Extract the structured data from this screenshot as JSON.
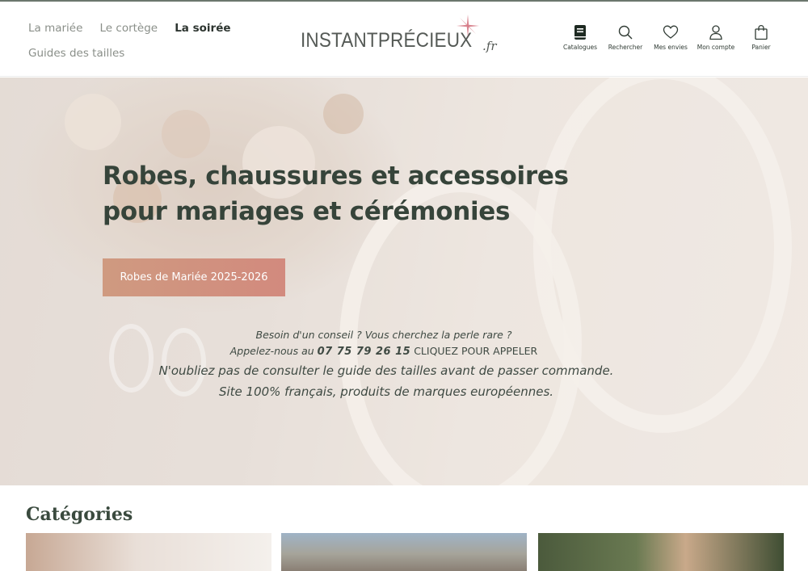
{
  "header": {
    "nav": [
      {
        "label": "La mariée",
        "active": false
      },
      {
        "label": "Le cortège",
        "active": false
      },
      {
        "label": "La soirée",
        "active": true
      },
      {
        "label": "Guides des tailles",
        "active": false
      }
    ],
    "logo": {
      "main": "INSTANTPRÉCIEUX",
      "suffix": ".fr"
    },
    "icons": [
      {
        "name": "catalog-icon",
        "label": "Catalogues"
      },
      {
        "name": "search-icon",
        "label": "Rechercher"
      },
      {
        "name": "heart-icon",
        "label": "Mes envies"
      },
      {
        "name": "user-icon",
        "label": "Mon compte"
      },
      {
        "name": "bag-icon",
        "label": "Panier"
      }
    ]
  },
  "hero": {
    "title": "Robes, chaussures et accessoires pour mariages et cérémonies",
    "button": "Robes de Mariée 2025-2026",
    "info_line1": "Besoin d'un conseil ? Vous cherchez la perle rare ?",
    "info_line2_prefix": "Appelez-nous au",
    "phone": "07 75 79 26 15",
    "cta": "CLIQUEZ POUR APPELER",
    "info_line3": "N'oubliez pas de consulter le guide des tailles avant de passer commande.",
    "info_line4": "Site 100% français, produits de marques européennes."
  },
  "categories": {
    "title": "Catégories"
  },
  "colors": {
    "accent_button": "#cf9a80",
    "text_dark": "#36443a",
    "logo_star": "#d2707c"
  }
}
